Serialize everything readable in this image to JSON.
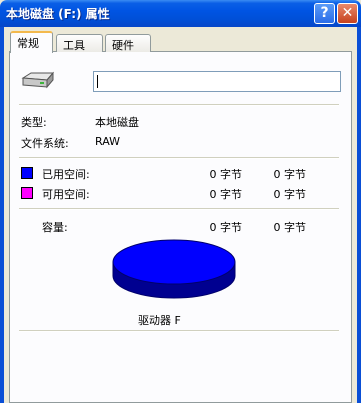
{
  "title": "本地磁盘 (F:) 属性",
  "title_buttons": {
    "help": "?",
    "close": "✕"
  },
  "tabs": [
    {
      "label": "常规",
      "active": true
    },
    {
      "label": "工具",
      "active": false
    },
    {
      "label": "硬件",
      "active": false
    }
  ],
  "volume_name": {
    "value": "",
    "placeholder": ""
  },
  "info": {
    "type_label": "类型:",
    "type_value": "本地磁盘",
    "fs_label": "文件系统:",
    "fs_value": "RAW"
  },
  "space": {
    "used_label": "已用空间:",
    "used_bytes": "0 字节",
    "used_size": "0 字节",
    "free_label": "可用空间:",
    "free_bytes": "0 字节",
    "free_size": "0 字节",
    "capacity_label": "容量:",
    "capacity_bytes": "0 字节",
    "capacity_size": "0 字节"
  },
  "colors": {
    "used": "#0000ff",
    "free": "#ff00ff"
  },
  "drive_label": "驱动器 F",
  "icons": {
    "drive": "hard-drive-icon",
    "used_swatch": "used-space-swatch",
    "free_swatch": "free-space-swatch",
    "pie": "disk-usage-pie"
  }
}
